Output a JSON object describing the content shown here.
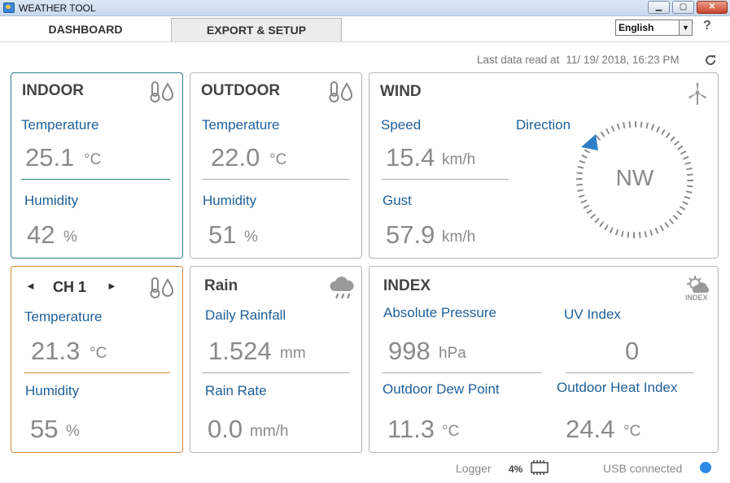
{
  "window": {
    "title": "WEATHER TOOL"
  },
  "tabs": [
    {
      "label": "DASHBOARD"
    },
    {
      "label": "EXPORT & SETUP"
    }
  ],
  "language": {
    "selected": "English"
  },
  "help_label": "?",
  "last_read": {
    "label": "Last data read at",
    "timestamp": "11/ 19/ 2018, 16:23 PM"
  },
  "indoor": {
    "title": "INDOOR",
    "temperature": {
      "label": "Temperature",
      "value": "25.1",
      "unit": "°C"
    },
    "humidity": {
      "label": "Humidity",
      "value": "42",
      "unit": "%"
    }
  },
  "outdoor": {
    "title": "OUTDOOR",
    "temperature": {
      "label": "Temperature",
      "value": "22.0",
      "unit": "°C"
    },
    "humidity": {
      "label": "Humidity",
      "value": "51",
      "unit": "%"
    }
  },
  "wind": {
    "title": "WIND",
    "speed": {
      "label": "Speed",
      "value": "15.4",
      "unit": "km/h"
    },
    "gust": {
      "label": "Gust",
      "value": "57.9",
      "unit": "km/h"
    },
    "direction": {
      "label": "Direction",
      "value": "NW"
    }
  },
  "channel": {
    "title": "CH 1",
    "prev": "◄",
    "next": "►",
    "temperature": {
      "label": "Temperature",
      "value": "21.3",
      "unit": "°C"
    },
    "humidity": {
      "label": "Humidity",
      "value": "55",
      "unit": "%"
    }
  },
  "rain": {
    "title": "Rain",
    "daily": {
      "label": "Daily Rainfall",
      "value": "1.524",
      "unit": "mm"
    },
    "rate": {
      "label": "Rain Rate",
      "value": "0.0",
      "unit": "mm/h"
    }
  },
  "index": {
    "title": "INDEX",
    "icon_label": "INDEX",
    "pressure": {
      "label": "Absolute Pressure",
      "value": "998",
      "unit": "hPa"
    },
    "uv": {
      "label": "UV Index",
      "value": "0"
    },
    "dew_point": {
      "label": "Outdoor Dew Point",
      "value": "11.3",
      "unit": "°C"
    },
    "heat_index": {
      "label": "Outdoor Heat Index",
      "value": "24.4",
      "unit": "°C"
    }
  },
  "status": {
    "logger_label": "Logger",
    "logger_percent": "4%",
    "usb_label": "USB connected"
  },
  "colors": {
    "label_blue": "#1f5f99",
    "value_gray": "#8a8a8a",
    "indoor_border": "#2e7f86",
    "channel_border": "#d28a3a",
    "usb_indicator": "#2e8ae6",
    "compass_pointer": "#2f7fc8"
  },
  "icons": {
    "thermo": "thermometer-drop-icon",
    "wind": "wind-turbine-icon",
    "rain": "rain-cloud-icon",
    "index": "sun-cloud-icon",
    "refresh": "refresh-icon",
    "chip": "memory-chip-icon"
  }
}
